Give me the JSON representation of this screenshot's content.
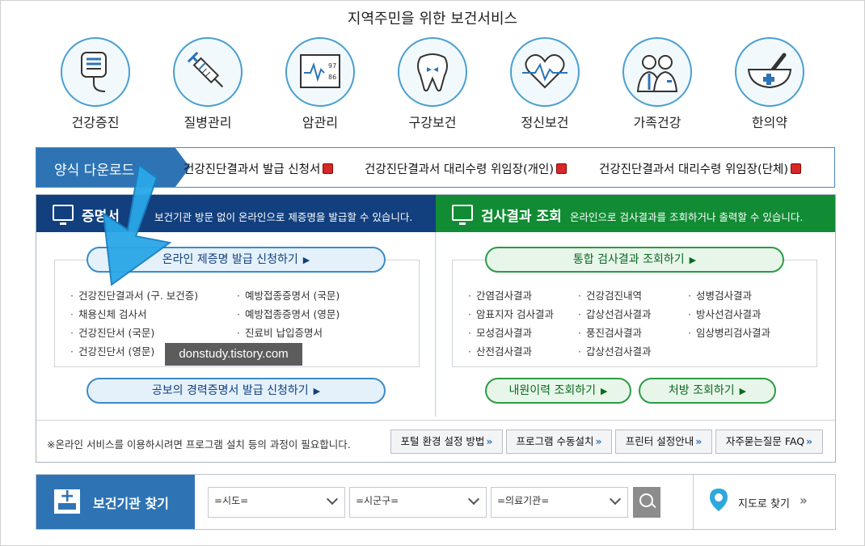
{
  "page": {
    "title": "지역주민을 위한 보건서비스"
  },
  "services": [
    {
      "label": "건강증진",
      "icon": "iv-bag-icon"
    },
    {
      "label": "질병관리",
      "icon": "syringe-icon"
    },
    {
      "label": "암관리",
      "icon": "monitor-vitals-icon"
    },
    {
      "label": "구강보건",
      "icon": "tooth-icon"
    },
    {
      "label": "정신보건",
      "icon": "heart-pulse-icon"
    },
    {
      "label": "가족건강",
      "icon": "family-doctors-icon"
    },
    {
      "label": "한의약",
      "icon": "mortar-pestle-icon"
    }
  ],
  "forms": {
    "head": "양식 다운로드",
    "links": [
      "건강진단결과서 발급 신청서",
      "건강진단결과서 대리수령 위임장(개인)",
      "건강진단결과서 대리수령 위임장(단체)"
    ]
  },
  "cert": {
    "name": "증명서",
    "desc": "보건기관 방문 없이 온라인으로 제증명을 발급할 수 있습니다.",
    "apply_button": "온라인 제증명 발급 신청하기",
    "items_col1": [
      "건강진단결과서 (구. 보건증)",
      "채용신체 검사서",
      "건강진단서 (국문)",
      "건강진단서 (영문)"
    ],
    "items_col2": [
      "예방접종증명서 (국문)",
      "예방접종증명서 (영문)",
      "진료비 납입증명서"
    ],
    "career_button": "공보의 경력증명서 발급 신청하기"
  },
  "results": {
    "name": "검사결과 조회",
    "desc": "온라인으로 검사결과를 조회하거나 출력할 수 있습니다.",
    "query_button": "통합 검사결과 조회하기",
    "items_col1": [
      "간염검사결과",
      "암표지자 검사결과",
      "모성검사결과",
      "산전검사결과"
    ],
    "items_col2": [
      "건강검진내역",
      "갑상선검사결과",
      "풍진검사결과",
      "갑상선검사결과"
    ],
    "items_col3": [
      "성병검사결과",
      "방사선검사결과",
      "임상병리검사결과"
    ],
    "visit_button": "내원이력 조회하기",
    "rx_button": "처방 조회하기"
  },
  "watermark": "donstudy.tistory.com",
  "notice": {
    "text": "※온라인 서비스를 이용하시려면 프로그램 설치 등의 과정이 필요합니다.",
    "buttons": [
      "포털 환경 설정 방법",
      "프로그램 수동설치",
      "프린터 설정안내",
      "자주묻는질문 FAQ"
    ]
  },
  "finder": {
    "head": "보건기관 찾기",
    "selects": [
      "=시도=",
      "=시군구=",
      "=의료기관="
    ],
    "map_link": "지도로 찾기"
  },
  "colors": {
    "blue": "#2e74b5",
    "navy": "#123f7e",
    "green": "#118c34",
    "accent_arrow": "#2aa7e8"
  }
}
